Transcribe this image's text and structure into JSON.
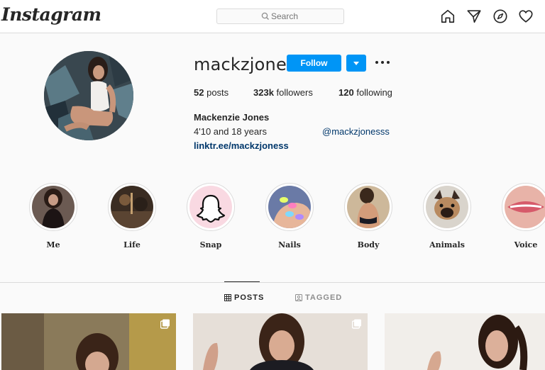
{
  "topbar": {
    "logo": "Instagram",
    "search_placeholder": "Search",
    "icons": [
      "home-icon",
      "direct-message-icon",
      "explore-icon",
      "activity-heart-icon"
    ]
  },
  "profile": {
    "username": "mackzjones",
    "follow_label": "Follow",
    "stats": {
      "posts_count": "52",
      "posts_label": "posts",
      "followers_count": "323k",
      "followers_label": "followers",
      "following_count": "120",
      "following_label": "following"
    },
    "full_name": "Mackenzie Jones",
    "bio_line": "4'10 and 18 years",
    "bio_mention": "@mackzjonesss",
    "link": "linktr.ee/mackzjoness"
  },
  "highlights": [
    {
      "label": "Me"
    },
    {
      "label": "Life"
    },
    {
      "label": "Snap"
    },
    {
      "label": "Nails"
    },
    {
      "label": "Body"
    },
    {
      "label": "Animals"
    },
    {
      "label": "Voice"
    }
  ],
  "tabs": {
    "posts_label": "POSTS",
    "tagged_label": "TAGGED"
  },
  "colors": {
    "accent": "#0095f6",
    "link": "#00376b",
    "border": "#dbdbdb",
    "background": "#fafafa"
  }
}
